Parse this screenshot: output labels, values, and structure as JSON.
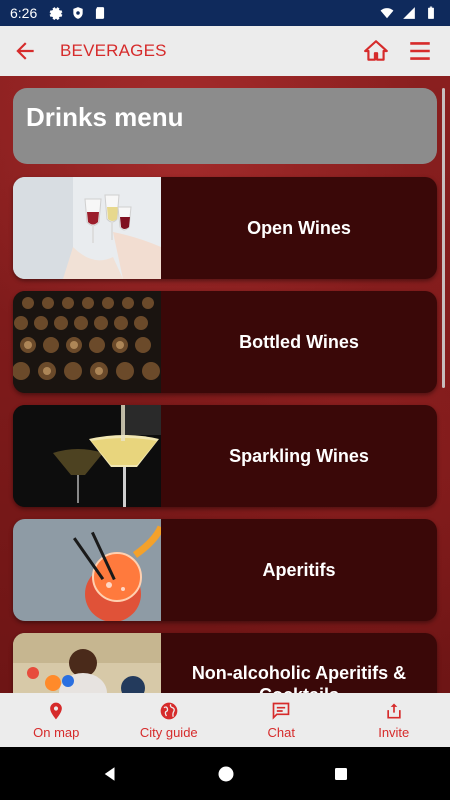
{
  "status": {
    "time": "6:26"
  },
  "appbar": {
    "title": "BEVERAGES"
  },
  "header": {
    "title": "Drinks menu"
  },
  "items": [
    {
      "label": "Open Wines"
    },
    {
      "label": "Bottled Wines"
    },
    {
      "label": "Sparkling Wines"
    },
    {
      "label": "Aperitifs"
    },
    {
      "label": "Non-alcoholic Aperitifs & Cocktails"
    }
  ],
  "bottomnav": {
    "map": "On map",
    "guide": "City guide",
    "chat": "Chat",
    "invite": "Invite"
  },
  "colors": {
    "accent": "#d62b2b",
    "statusbar": "#0f2a5c",
    "card": "#3a0808"
  }
}
